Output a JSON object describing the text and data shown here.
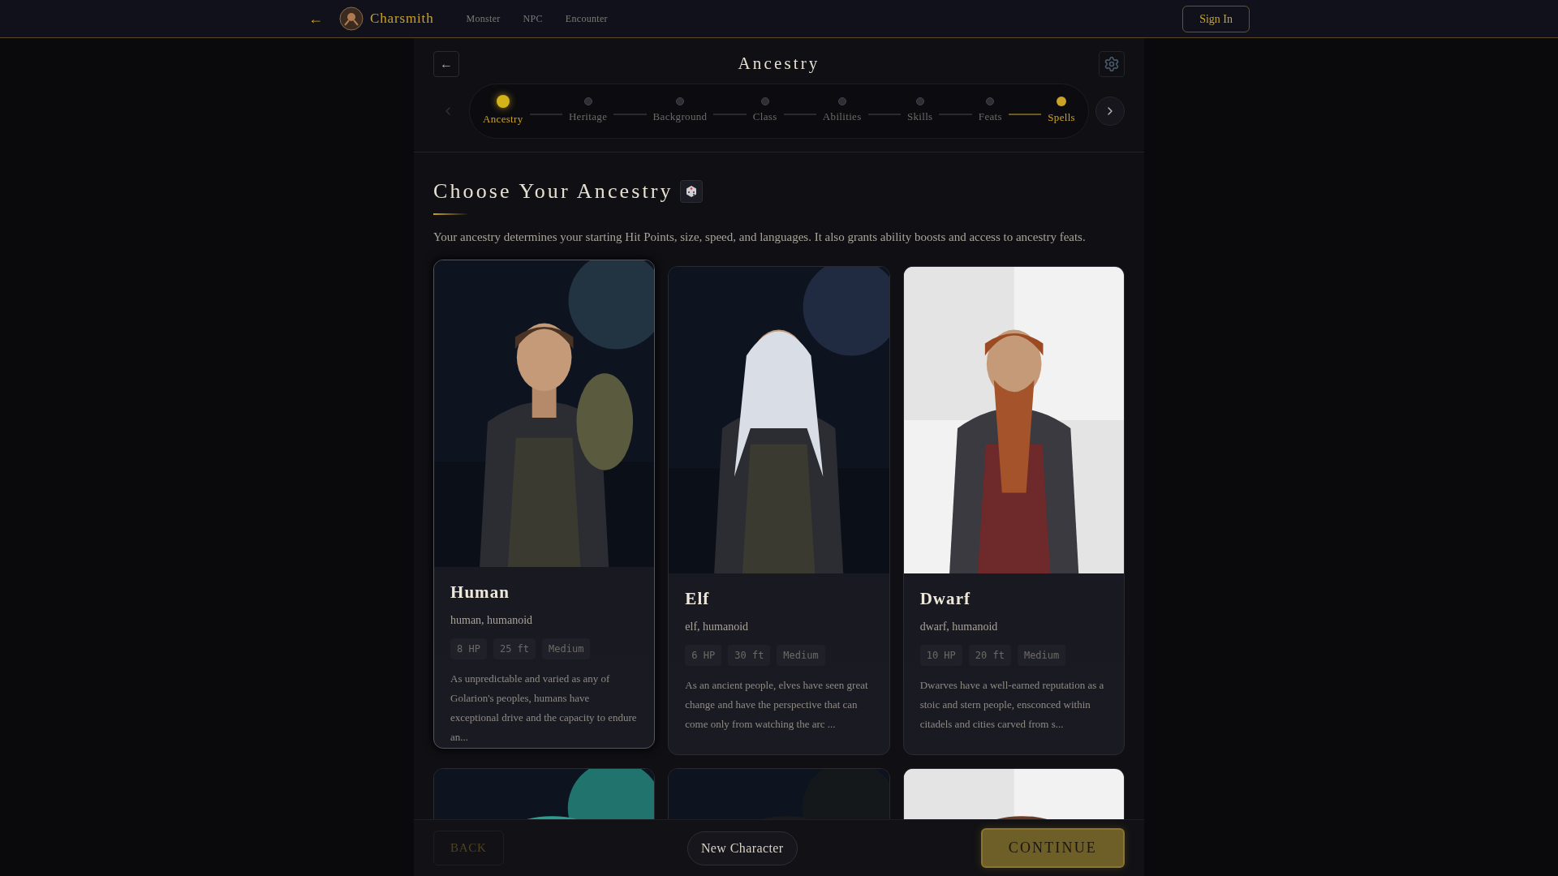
{
  "nav": {
    "back": "←",
    "brand": "Charsmith",
    "links": [
      "Monster",
      "NPC",
      "Encounter"
    ],
    "sign_in": "Sign In"
  },
  "header": {
    "back": "←",
    "title": "Ancestry"
  },
  "steps": [
    {
      "label": "Ancestry",
      "selected": true,
      "highlighted": true
    },
    {
      "label": "Heritage",
      "selected": false,
      "highlighted": false
    },
    {
      "label": "Background",
      "selected": false,
      "highlighted": false
    },
    {
      "label": "Class",
      "selected": false,
      "highlighted": false
    },
    {
      "label": "Abilities",
      "selected": false,
      "highlighted": false
    },
    {
      "label": "Skills",
      "selected": false,
      "highlighted": false
    },
    {
      "label": "Feats",
      "selected": false,
      "highlighted": false
    },
    {
      "label": "Spells",
      "selected": false,
      "highlighted": true
    }
  ],
  "section": {
    "title": "Choose Your Ancestry",
    "description": "Your ancestry determines your starting Hit Points, size, speed, and languages. It also grants ability boosts and access to ancestry feats."
  },
  "cards": [
    {
      "name": "Human",
      "traits": "human, humanoid",
      "tags": [
        "8 HP",
        "25 ft",
        "Medium"
      ],
      "description": "As unpredictable and varied as any of Golarion's peoples, humans have exceptional drive and the capacity to endure an...",
      "selected": true
    },
    {
      "name": "Elf",
      "traits": "elf, humanoid",
      "tags": [
        "6 HP",
        "30 ft",
        "Medium"
      ],
      "description": "As an ancient people, elves have seen great change and have the perspective that can come only from watching the arc ...",
      "selected": false
    },
    {
      "name": "Dwarf",
      "traits": "dwarf, humanoid",
      "tags": [
        "10 HP",
        "20 ft",
        "Medium"
      ],
      "description": "Dwarves have a well-earned reputation as a stoic and stern people, ensconced within citadels and cities carved from s...",
      "selected": false
    }
  ],
  "footer": {
    "back": "BACK",
    "new_character": "New Character",
    "continue": "CONTINUE"
  }
}
